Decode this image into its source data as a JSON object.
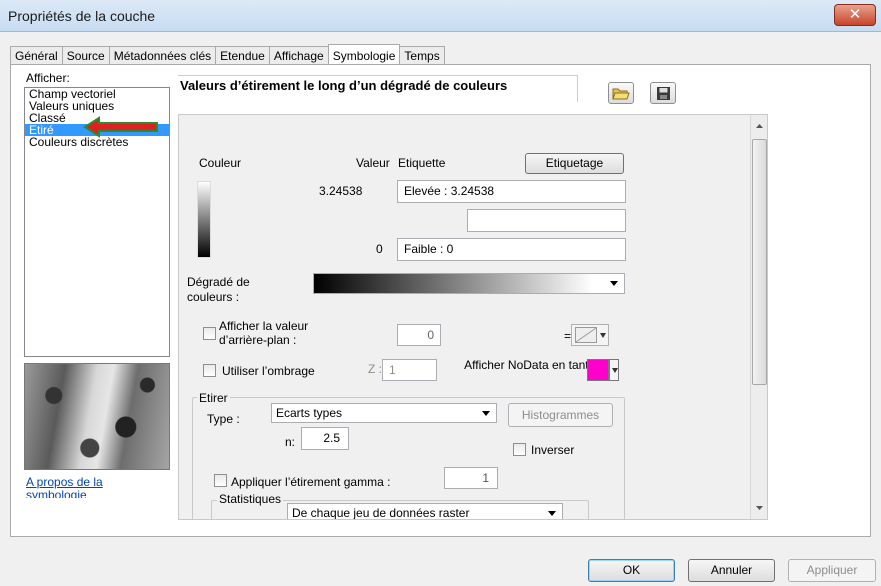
{
  "window": {
    "title": "Propriétés de la couche",
    "close_glyph": "✕"
  },
  "tabs": [
    {
      "label": "Général"
    },
    {
      "label": "Source"
    },
    {
      "label": "Métadonnées clés"
    },
    {
      "label": "Etendue"
    },
    {
      "label": "Affichage"
    },
    {
      "label": "Symbologie",
      "active": true
    },
    {
      "label": "Temps"
    }
  ],
  "sidebar": {
    "show_label": "Afficher:",
    "items": [
      "Champ vectoriel",
      "Valeurs uniques",
      "Classé",
      "Etiré",
      "Couleurs discrètes"
    ],
    "selected": "Etiré",
    "about_link": "A propos de la symbologie"
  },
  "main": {
    "heading": "Valeurs d’étirement le long d’un dégradé de couleurs",
    "open_icon": "folder-open-icon",
    "save_icon": "save-disk-icon",
    "color_label": "Couleur",
    "value_label": "Valeur",
    "etiquette_label": "Etiquette",
    "etiquetage_button": "Etiquetage",
    "high_value": "3.24538",
    "high_label": "Elevée : 3.24538",
    "mid_label": "",
    "low_value": "0",
    "low_label": "Faible : 0",
    "ramp_label": "Dégradé de couleurs :",
    "bg_checkbox_label": "Afficher la valeur d’arrière-plan :",
    "bg_value": "0",
    "bg_color_prefix": "=",
    "hillshade_label": "Utiliser l’ombrage",
    "z_label": "Z :",
    "z_value": "1",
    "nodata_label": "Afficher NoData en tant que",
    "nodata_color": "#ff00cc",
    "stretch_group": "Etirer",
    "type_label": "Type :",
    "type_value": "Ecarts types",
    "histogram_button": "Histogrammes",
    "n_label": "n:",
    "n_value": "2.5",
    "invert_label": "Inverser",
    "gamma_label": "Appliquer l’étirement gamma :",
    "gamma_value": "1",
    "stats_label": "Statistiques",
    "stats_value": "De chaque jeu de données raster"
  },
  "footer": {
    "ok": "OK",
    "cancel": "Annuler",
    "apply": "Appliquer"
  },
  "colors": {
    "selection": "#3399ff",
    "arrow_fill": "#e02020",
    "arrow_border": "#2f8a2f"
  }
}
